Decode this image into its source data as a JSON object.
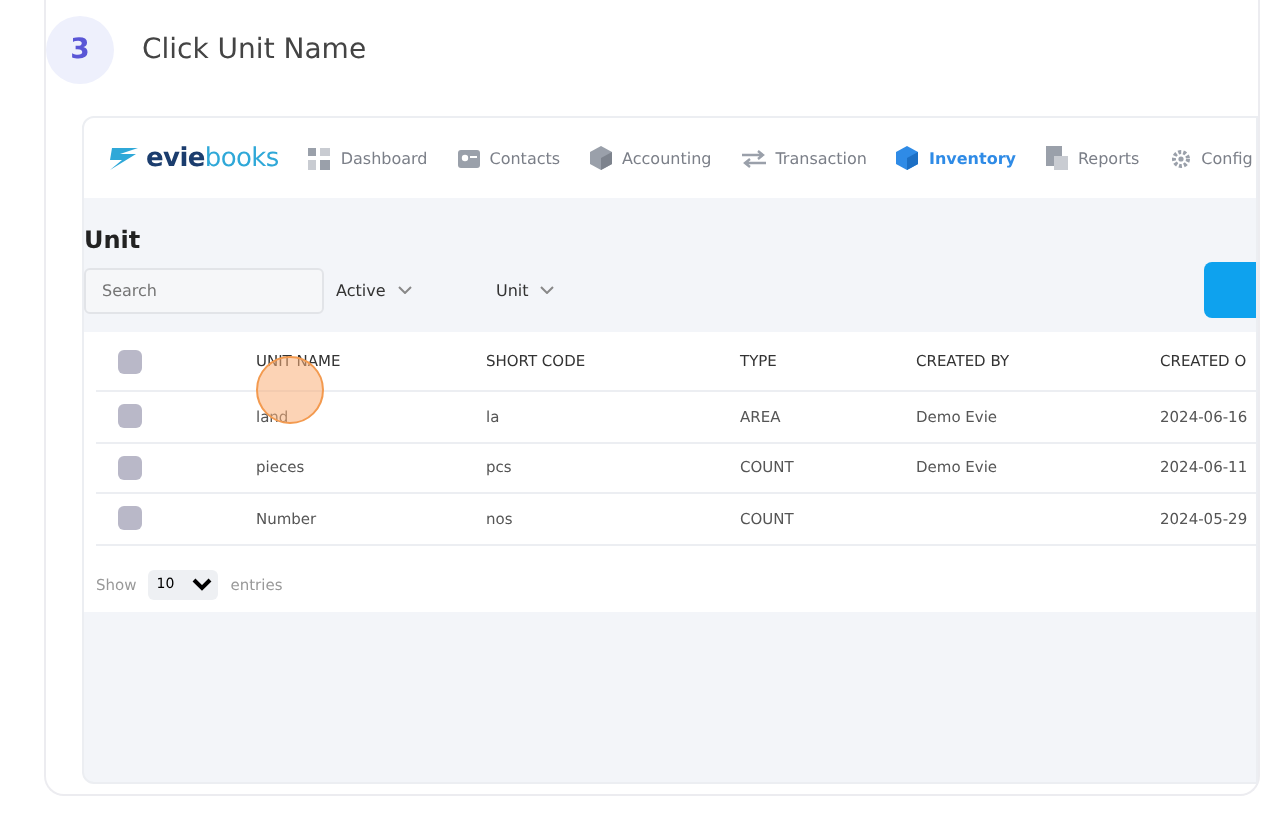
{
  "step": {
    "number": "3",
    "title": "Click Unit Name"
  },
  "app": {
    "logo": {
      "part1": "evie",
      "part2": "books"
    },
    "nav": [
      {
        "label": "Dashboard",
        "kind": "grid",
        "selected": false
      },
      {
        "label": "Contacts",
        "kind": "card",
        "selected": false
      },
      {
        "label": "Accounting",
        "kind": "cube",
        "selected": false
      },
      {
        "label": "Transaction",
        "kind": "arrows",
        "selected": false
      },
      {
        "label": "Inventory",
        "kind": "cube",
        "selected": true
      },
      {
        "label": "Reports",
        "kind": "report",
        "selected": false
      },
      {
        "label": "Config",
        "kind": "gear",
        "selected": false
      }
    ],
    "page_title": "Unit",
    "search": {
      "placeholder": "Search"
    },
    "filters": [
      "Active",
      "Unit"
    ],
    "table": {
      "header_checked": false,
      "columns": [
        "UNIT NAME",
        "SHORT CODE",
        "TYPE",
        "CREATED BY",
        "CREATED O"
      ],
      "rows": [
        {
          "checked": false,
          "cells": [
            "land",
            "la",
            "AREA",
            "Demo Evie",
            "2024-06-16"
          ]
        },
        {
          "checked": false,
          "cells": [
            "pieces",
            "pcs",
            "COUNT",
            "Demo Evie",
            "2024-06-11"
          ]
        },
        {
          "checked": false,
          "cells": [
            "Number",
            "nos",
            "COUNT",
            "",
            "2024-05-29"
          ]
        }
      ]
    },
    "footer": {
      "show": "Show",
      "page_size": "10",
      "entries": "entries"
    }
  }
}
